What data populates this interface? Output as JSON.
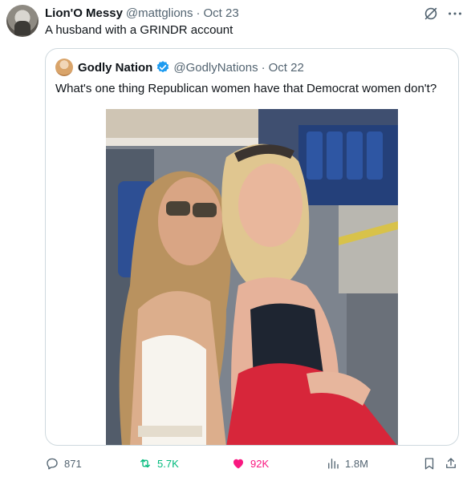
{
  "tweet": {
    "author_name": "Lion'O Messy",
    "author_handle": "@mattglions",
    "separator": "·",
    "date": "Oct 23",
    "text": "A husband with a GRINDR account"
  },
  "quoted_tweet": {
    "author_name": "Godly Nation",
    "author_handle": "@GodlyNations",
    "separator": "·",
    "date": "Oct 22",
    "text": "What's one thing Republican women have that Democrat women don't?",
    "verified": true
  },
  "actions": {
    "reply_count": "871",
    "repost_count": "5.7K",
    "like_count": "92K",
    "view_count": "1.8M"
  },
  "colors": {
    "text_primary": "#0f1419",
    "text_secondary": "#536471",
    "border": "#cfd9de",
    "repost_active": "#00ba7c",
    "like_active": "#f91880",
    "verified_blue": "#1d9bf0"
  },
  "icons": [
    "grok-icon",
    "more-icon",
    "verified-icon",
    "reply-icon",
    "repost-icon",
    "heart-icon",
    "views-icon",
    "bookmark-icon",
    "share-icon"
  ]
}
